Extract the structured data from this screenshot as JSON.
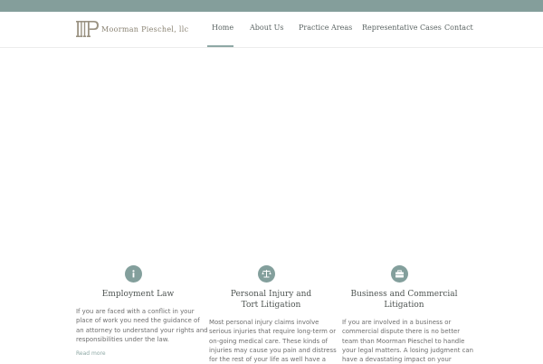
{
  "brand": {
    "name": "Moorman Pieschel, llc",
    "logo_mark": "MP"
  },
  "nav": {
    "items": [
      {
        "label": "Home",
        "active": true
      },
      {
        "label": "About Us",
        "active": false
      },
      {
        "label": "Practice Areas",
        "active": false
      },
      {
        "label": "Representative Cases",
        "active": false
      },
      {
        "label": "Contact",
        "active": false
      }
    ]
  },
  "features": [
    {
      "icon": "info-icon",
      "title_lines": [
        "Employment Law"
      ],
      "text_lines": [
        "If you are faced with a conflict in your",
        "place of work you need the guidance of",
        "an attorney to understand your rights and",
        "responsibilities under the law."
      ],
      "link": "Read more"
    },
    {
      "icon": "scales-icon",
      "title_lines": [
        "Personal Injury and",
        "Tort Litigation"
      ],
      "text_lines": [
        "Most personal injury claims involve",
        "serious injuries that require long-term or",
        "on-going medical care. These kinds of",
        "injuries may cause you pain and distress",
        "for the rest of your life as well have a"
      ]
    },
    {
      "icon": "briefcase-icon",
      "title_lines": [
        "Business and Commercial",
        "Litigation"
      ],
      "text_lines": [
        "If you are involved in a business or",
        "commercial dispute there is no better",
        "team than Moorman Pieschel to handle",
        "your legal matters. A losing judgment can",
        "have a devastating impact on your"
      ]
    }
  ],
  "colors": {
    "accent": "#839f9c",
    "topbar": "#849e9b",
    "logo": "#8a8373",
    "text": "#6e6e6e"
  }
}
